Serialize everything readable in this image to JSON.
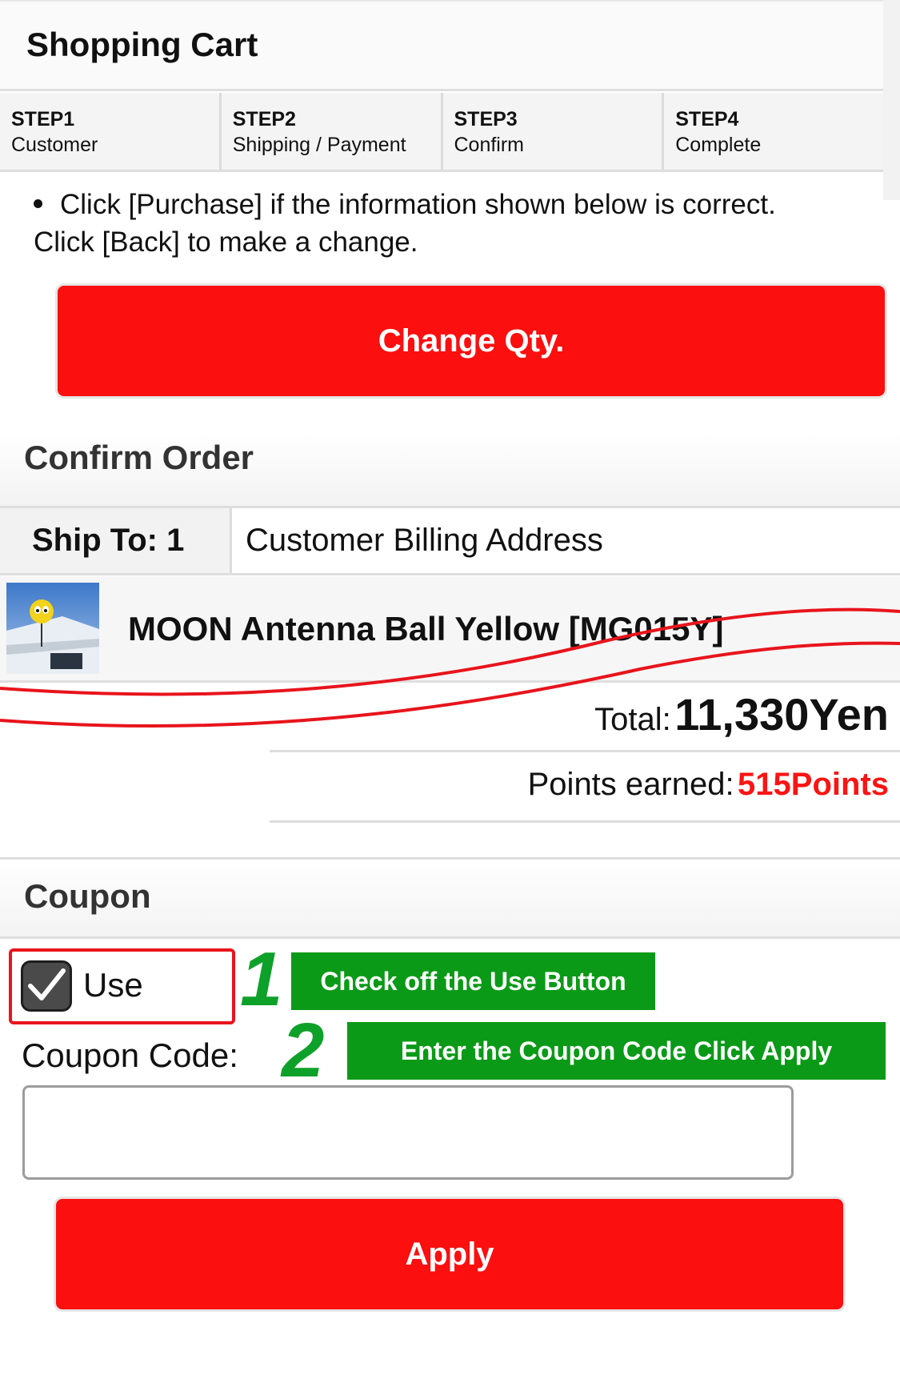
{
  "header": {
    "title": "Shopping Cart"
  },
  "steps": [
    {
      "num": "STEP1",
      "label": "Customer"
    },
    {
      "num": "STEP2",
      "label": "Shipping / Payment"
    },
    {
      "num": "STEP3",
      "label": "Confirm"
    },
    {
      "num": "STEP4",
      "label": "Complete"
    }
  ],
  "instruction": {
    "line1": "Click [Purchase] if the information shown below is correct.",
    "line2": "Click [Back] to make a change."
  },
  "change_qty_label": "Change Qty.",
  "confirm_order": {
    "title": "Confirm Order",
    "ship_to_label": "Ship To: 1",
    "ship_to_value": "Customer Billing Address",
    "product_name": "MOON Antenna Ball Yellow [MG015Y]",
    "total_label": "Total:",
    "total_value": "11,330Yen",
    "points_label": "Points earned:",
    "points_value": "515Points"
  },
  "coupon": {
    "title": "Coupon",
    "use_label": "Use",
    "use_checked": true,
    "code_label": "Coupon Code:",
    "code_value": "",
    "apply_label": "Apply"
  },
  "annotations": {
    "step1_num": "1",
    "step1_text": "Check off the Use Button",
    "step2_num": "2",
    "step2_text": "Enter the Coupon Code Click Apply"
  },
  "colors": {
    "button_red": "#fb0f0f",
    "points_red": "#fb1414",
    "annotation_green": "#0b9a17",
    "highlight_red": "#e8141c"
  }
}
